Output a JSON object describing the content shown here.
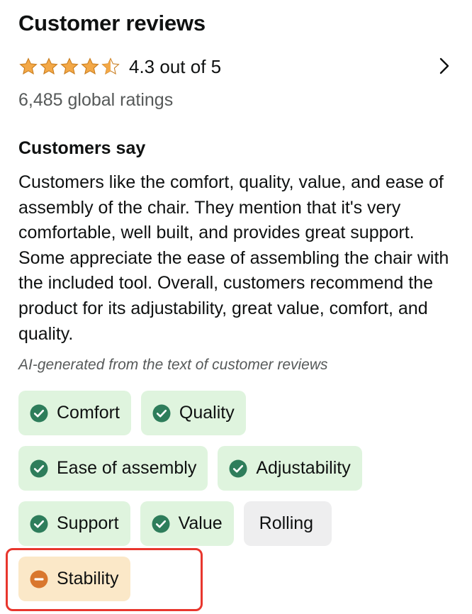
{
  "header": {
    "title": "Customer reviews"
  },
  "rating": {
    "value": 4.3,
    "text": "4.3 out of 5",
    "star_color": "#f3a847",
    "stars": [
      "full",
      "full",
      "full",
      "full",
      "half"
    ]
  },
  "global_ratings": "6,485 global ratings",
  "customers_say": {
    "heading": "Customers say",
    "summary": "Customers like the comfort, quality, value, and ease of assembly of the chair. They mention that it's very comfortable, well built, and provides great support. Some appreciate the ease of assembling the chair with the included tool. Overall, customers recommend the product for its adjustability, great value, comfort, and quality.",
    "ai_note": "AI-generated from the text of customer reviews"
  },
  "tags": [
    {
      "label": "Comfort",
      "sentiment": "positive",
      "icon": "check-circle-icon"
    },
    {
      "label": "Quality",
      "sentiment": "positive",
      "icon": "check-circle-icon"
    },
    {
      "label": "Ease of assembly",
      "sentiment": "positive",
      "icon": "check-circle-icon"
    },
    {
      "label": "Adjustability",
      "sentiment": "positive",
      "icon": "check-circle-icon"
    },
    {
      "label": "Support",
      "sentiment": "positive",
      "icon": "check-circle-icon"
    },
    {
      "label": "Value",
      "sentiment": "positive",
      "icon": "check-circle-icon"
    },
    {
      "label": "Rolling",
      "sentiment": "neutral",
      "icon": ""
    },
    {
      "label": "Stability",
      "sentiment": "negative",
      "icon": "minus-circle-icon"
    }
  ],
  "colors": {
    "positive_bg": "#dff4de",
    "positive_icon": "#2e7d5b",
    "neutral_bg": "#eeeeef",
    "negative_bg": "#fbe8c8",
    "negative_icon": "#d9772e",
    "highlight_border": "#e8362d"
  }
}
